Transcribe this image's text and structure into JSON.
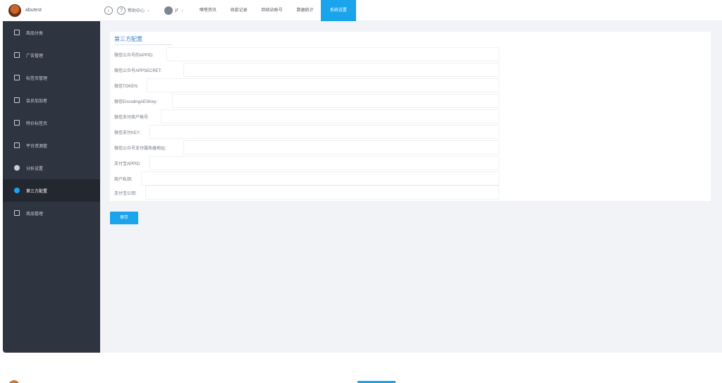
{
  "brand": {
    "name": "abutest"
  },
  "topbar": {
    "help_center": "帮助中心",
    "user_name": "yf",
    "nav": [
      {
        "label": "嘀嗒资讯"
      },
      {
        "label": "收款记录"
      },
      {
        "label": "回收站账号"
      },
      {
        "label": "数据统计"
      },
      {
        "label": "系统设置"
      }
    ]
  },
  "sidebar": {
    "items": [
      {
        "label": "商品分类"
      },
      {
        "label": "广告管理"
      },
      {
        "label": "标签页管理"
      },
      {
        "label": "会员加加者"
      },
      {
        "label": "特价标签页"
      },
      {
        "label": "平台资源管"
      },
      {
        "label": "分析设置"
      },
      {
        "label": "第三方配置"
      },
      {
        "label": "商品管理"
      }
    ]
  },
  "panel": {
    "title": "第三方配置",
    "fields": [
      {
        "label": "微信公众号的APPID:",
        "value": ""
      },
      {
        "label": "微信公众号APPSECRET:",
        "value": ""
      },
      {
        "label": "微信TOKEN:",
        "value": ""
      },
      {
        "label": "微信EncodingAESKey:",
        "value": ""
      },
      {
        "label": "微信支付商户帐号:",
        "value": ""
      },
      {
        "label": "微信支付KEY:",
        "value": ""
      },
      {
        "label": "微信公众号支付服务器地址:",
        "value": ""
      },
      {
        "label": "支付宝APPID:",
        "value": ""
      },
      {
        "label": "商户私钥:",
        "value": ""
      },
      {
        "label": "支付宝公钥:",
        "value": ""
      }
    ]
  },
  "actions": {
    "save_label": "保存"
  },
  "colors": {
    "accent": "#1aa4ec",
    "sidebar_bg": "#2f3540",
    "main_bg": "#f1f3f7"
  }
}
